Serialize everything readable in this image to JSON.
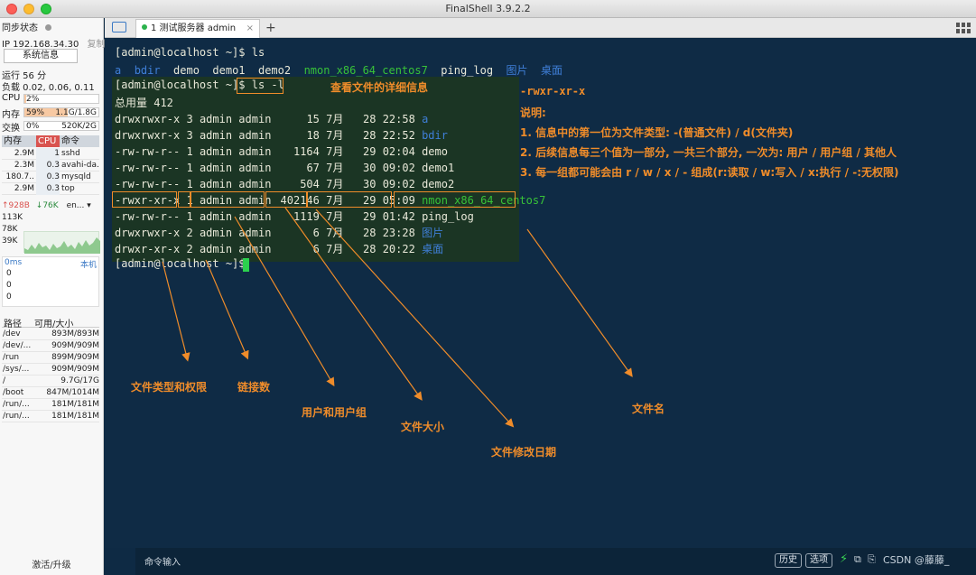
{
  "window": {
    "title": "FinalShell 3.9.2.2"
  },
  "sidebar": {
    "sync_label": "同步状态",
    "ip": "IP 192.168.34.30",
    "copy": "复制",
    "sys_info_button": "系统信息",
    "uptime": "运行 56 分",
    "load": "负载 0.02, 0.06, 0.11",
    "cpu_label": "CPU",
    "cpu_value": "2%",
    "cpu_fraction": 0.02,
    "mem_label": "内存",
    "mem_percent": "59%",
    "mem_value": "1.1G/1.8G",
    "mem_fraction": 0.59,
    "swap_label": "交换",
    "swap_percent": "0%",
    "swap_value": "520K/2G",
    "proc_headers": [
      "内存",
      "CPU",
      "命令"
    ],
    "processes": [
      {
        "mem": "2.9M",
        "cpu": "1",
        "cmd": "sshd"
      },
      {
        "mem": "2.3M",
        "cpu": "0.3",
        "cmd": "avahi-da."
      },
      {
        "mem": "180.7..",
        "cpu": "0.3",
        "cmd": "mysqld"
      },
      {
        "mem": "2.9M",
        "cpu": "0.3",
        "cmd": "top"
      }
    ],
    "net_up": "↑928B",
    "net_down": "↓76K",
    "net_iface": "en...",
    "net_scale": [
      "113K",
      "78K",
      "39K"
    ],
    "ping_label": "0ms",
    "ping_host": "本机",
    "ping_values": [
      "0",
      "0",
      "0"
    ],
    "disk_headers": [
      "路径",
      "可用/大小"
    ],
    "disks": [
      {
        "path": "/dev",
        "size": "893M/893M"
      },
      {
        "path": "/dev/...",
        "size": "909M/909M"
      },
      {
        "path": "/run",
        "size": "899M/909M"
      },
      {
        "path": "/sys/...",
        "size": "909M/909M"
      },
      {
        "path": "/",
        "size": "9.7G/17G"
      },
      {
        "path": "/boot",
        "size": "847M/1014M"
      },
      {
        "path": "/run/...",
        "size": "181M/181M"
      },
      {
        "path": "/run/...",
        "size": "181M/181M"
      }
    ],
    "activate": "激活/升级"
  },
  "tabs": [
    {
      "label": "1 测试服务器 admin",
      "close": "×"
    }
  ],
  "terminal": {
    "prompt1": "[admin@localhost ~]$ ls",
    "ls_items": [
      "a",
      "bdir",
      "demo",
      "demo1",
      "demo2",
      "nmon_x86_64_centos7",
      "ping_log",
      "图片",
      "桌面"
    ],
    "prompt2_prefix": "[admin@localhost ~]$ ",
    "prompt2_cmd": "ls -l",
    "total": "总用量 412",
    "rows": [
      {
        "perm": "drwxrwxr-x",
        "links": "3",
        "owner": "admin admin",
        "size": "15",
        "date": "7月   28 22:58",
        "name": "a",
        "color": "blue"
      },
      {
        "perm": "drwxrwxr-x",
        "links": "3",
        "owner": "admin admin",
        "size": "18",
        "date": "7月   28 22:52",
        "name": "bdir",
        "color": "blue"
      },
      {
        "perm": "-rw-rw-r--",
        "links": "1",
        "owner": "admin admin",
        "size": "1164",
        "date": "7月   29 02:04",
        "name": "demo",
        "color": "white"
      },
      {
        "perm": "-rw-rw-r--",
        "links": "1",
        "owner": "admin admin",
        "size": "67",
        "date": "7月   30 09:02",
        "name": "demo1",
        "color": "white"
      },
      {
        "perm": "-rw-rw-r--",
        "links": "1",
        "owner": "admin admin",
        "size": "504",
        "date": "7月   30 09:02",
        "name": "demo2",
        "color": "white"
      },
      {
        "perm": "-rwxr-xr-x",
        "links": "1",
        "owner": "admin admin",
        "size": "402146",
        "date": "7月   29 05:09",
        "name": "nmon_x86_64_centos7",
        "color": "green"
      },
      {
        "perm": "-rw-rw-r--",
        "links": "1",
        "owner": "admin admin",
        "size": "1119",
        "date": "7月   29 01:42",
        "name": "ping_log",
        "color": "white"
      },
      {
        "perm": "drwxrwxr-x",
        "links": "2",
        "owner": "admin admin",
        "size": "6",
        "date": "7月   28 23:28",
        "name": "图片",
        "color": "blue"
      },
      {
        "perm": "drwxr-xr-x",
        "links": "2",
        "owner": "admin admin",
        "size": "6",
        "date": "7月   28 20:22",
        "name": "桌面",
        "color": "blue"
      }
    ],
    "prompt3": "[admin@localhost ~]$ "
  },
  "annotations": {
    "title": "查看文件的详细信息",
    "perm_example": "-rwxr-xr-x",
    "explain_title": "说明:",
    "explain_1": "1. 信息中的第一位为文件类型: -(普通文件) / d(文件夹)",
    "explain_2": "2. 后续信息每三个值为一部分, 一共三个部分, 一次为: 用户 / 用户组 / 其他人",
    "explain_3": "3. 每一组都可能会由 r / w / x / - 组成(r:读取 / w:写入 / x:执行 / -:无权限)",
    "label_perm": "文件类型和权限",
    "label_links": "链接数",
    "label_owner": "用户和用户组",
    "label_size": "文件大小",
    "label_date": "文件修改日期",
    "label_name": "文件名",
    "accent_color": "#ef8c2a"
  },
  "bottombar": {
    "cmd_input": "命令输入",
    "history": "历史",
    "options": "选项",
    "watermark": "CSDN @藤藤_"
  }
}
